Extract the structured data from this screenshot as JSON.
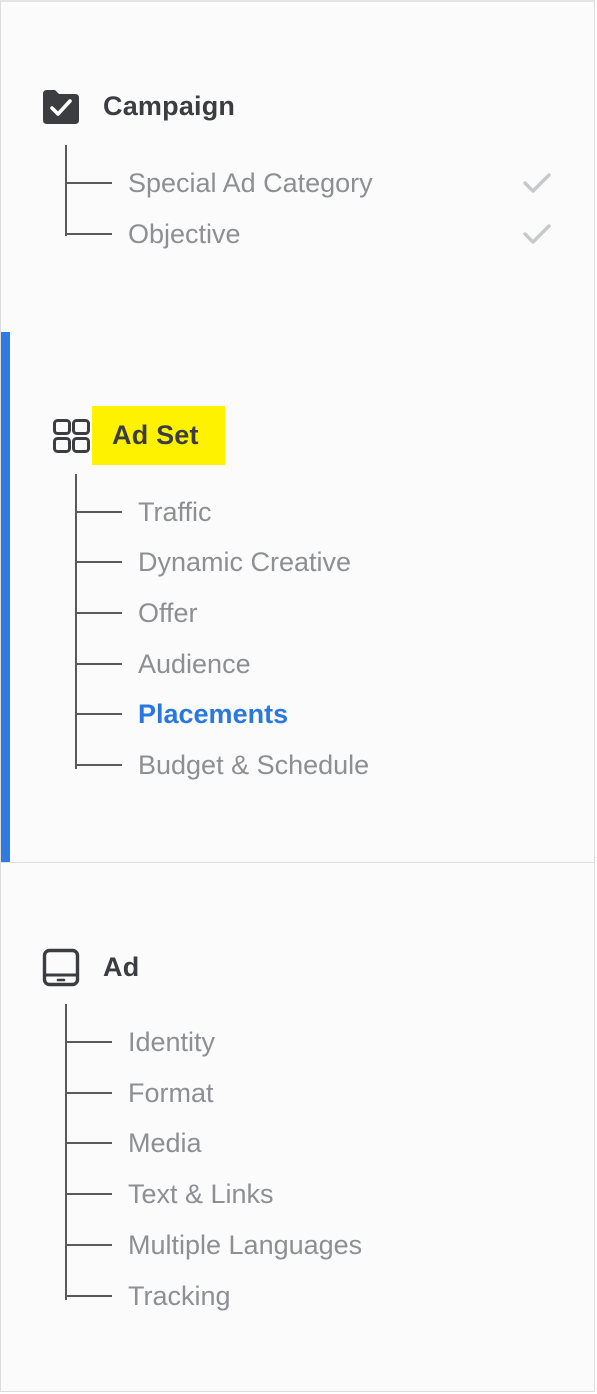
{
  "campaign": {
    "title": "Campaign",
    "icon": "folder-check-icon",
    "items": [
      {
        "label": "Special Ad Category",
        "status": "complete"
      },
      {
        "label": "Objective",
        "status": "complete"
      }
    ]
  },
  "adset": {
    "title": "Ad Set",
    "icon": "grid-icon",
    "highlighted": true,
    "active": true,
    "items": [
      {
        "label": "Traffic"
      },
      {
        "label": "Dynamic Creative"
      },
      {
        "label": "Offer"
      },
      {
        "label": "Audience"
      },
      {
        "label": "Placements",
        "active": true
      },
      {
        "label": "Budget & Schedule"
      }
    ]
  },
  "ad": {
    "title": "Ad",
    "icon": "tablet-icon",
    "items": [
      {
        "label": "Identity"
      },
      {
        "label": "Format"
      },
      {
        "label": "Media"
      },
      {
        "label": "Text & Links"
      },
      {
        "label": "Multiple Languages"
      },
      {
        "label": "Tracking"
      }
    ]
  },
  "colors": {
    "accent": "#2e7be4",
    "highlight": "#fef200",
    "active_text": "#2a78dd",
    "muted_text": "#8d8f93",
    "title_text": "#3b3d40"
  }
}
